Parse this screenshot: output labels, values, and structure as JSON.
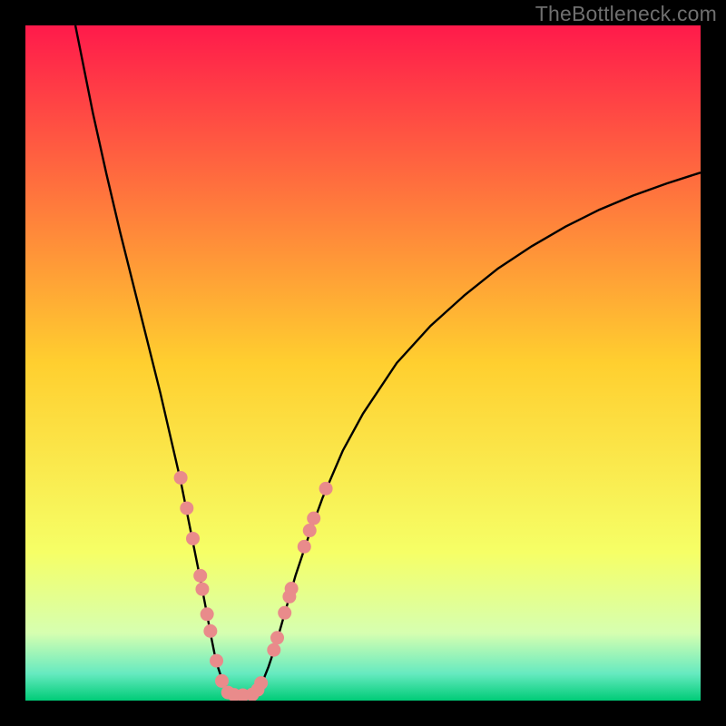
{
  "watermark": "TheBottleneck.com",
  "chart_data": {
    "type": "line",
    "title": "",
    "xlabel": "",
    "ylabel": "",
    "xlim": [
      0,
      100
    ],
    "ylim": [
      0,
      100
    ],
    "grid": false,
    "legend": false,
    "background_gradient": {
      "stops": [
        {
          "offset": 0.0,
          "color": "#ff1a4b"
        },
        {
          "offset": 0.5,
          "color": "#ffcf2f"
        },
        {
          "offset": 0.78,
          "color": "#f6ff66"
        },
        {
          "offset": 0.9,
          "color": "#d6ffb0"
        },
        {
          "offset": 0.96,
          "color": "#66eac0"
        },
        {
          "offset": 1.0,
          "color": "#00cc77"
        }
      ]
    },
    "series": [
      {
        "name": "left-curve",
        "color": "#000000",
        "x": [
          7.4,
          10,
          12,
          14,
          16,
          18,
          20,
          21.5,
          23,
          24,
          25,
          26,
          26.8,
          27.5,
          28,
          28.5,
          29,
          29.5,
          30,
          30.5,
          30.9
        ],
        "y": [
          100,
          87,
          78,
          69.5,
          61.5,
          53.5,
          45.5,
          39,
          32.5,
          27.5,
          22.5,
          17.5,
          13.3,
          9.5,
          7,
          5,
          3.5,
          2.4,
          1.6,
          1.1,
          0.85
        ]
      },
      {
        "name": "right-curve",
        "color": "#000000",
        "x": [
          33.5,
          34,
          35,
          36,
          37,
          38,
          40,
          42,
          44,
          47,
          50,
          55,
          60,
          65,
          70,
          75,
          80,
          85,
          90,
          95,
          100
        ],
        "y": [
          0.85,
          1.1,
          2.5,
          5.0,
          8.0,
          11.5,
          18.5,
          24.5,
          30,
          37,
          42.5,
          50,
          55.5,
          60,
          64,
          67.3,
          70.2,
          72.7,
          74.8,
          76.6,
          78.2
        ]
      },
      {
        "name": "bottom-bridge",
        "color": "#e98b8b",
        "x": [
          30.0,
          30.6,
          31.2,
          31.8,
          32.4,
          33.0,
          33.5,
          34.0
        ],
        "y": [
          1.0,
          0.85,
          0.8,
          0.8,
          0.8,
          0.82,
          0.88,
          1.0
        ]
      }
    ],
    "scatter": {
      "name": "pink-dots",
      "color": "#e98b8b",
      "points": [
        {
          "x": 23.0,
          "y": 33.0
        },
        {
          "x": 23.9,
          "y": 28.5
        },
        {
          "x": 24.8,
          "y": 24.0
        },
        {
          "x": 25.9,
          "y": 18.5
        },
        {
          "x": 26.2,
          "y": 16.5
        },
        {
          "x": 26.9,
          "y": 12.8
        },
        {
          "x": 27.4,
          "y": 10.3
        },
        {
          "x": 28.3,
          "y": 5.9
        },
        {
          "x": 29.1,
          "y": 2.9
        },
        {
          "x": 30.0,
          "y": 1.2
        },
        {
          "x": 30.9,
          "y": 0.85
        },
        {
          "x": 32.2,
          "y": 0.8
        },
        {
          "x": 33.6,
          "y": 0.9
        },
        {
          "x": 34.4,
          "y": 1.6
        },
        {
          "x": 34.9,
          "y": 2.6
        },
        {
          "x": 36.8,
          "y": 7.5
        },
        {
          "x": 37.3,
          "y": 9.3
        },
        {
          "x": 38.4,
          "y": 13.0
        },
        {
          "x": 39.1,
          "y": 15.4
        },
        {
          "x": 39.4,
          "y": 16.6
        },
        {
          "x": 41.3,
          "y": 22.8
        },
        {
          "x": 42.1,
          "y": 25.2
        },
        {
          "x": 42.7,
          "y": 27.0
        },
        {
          "x": 44.5,
          "y": 31.4
        }
      ]
    }
  }
}
